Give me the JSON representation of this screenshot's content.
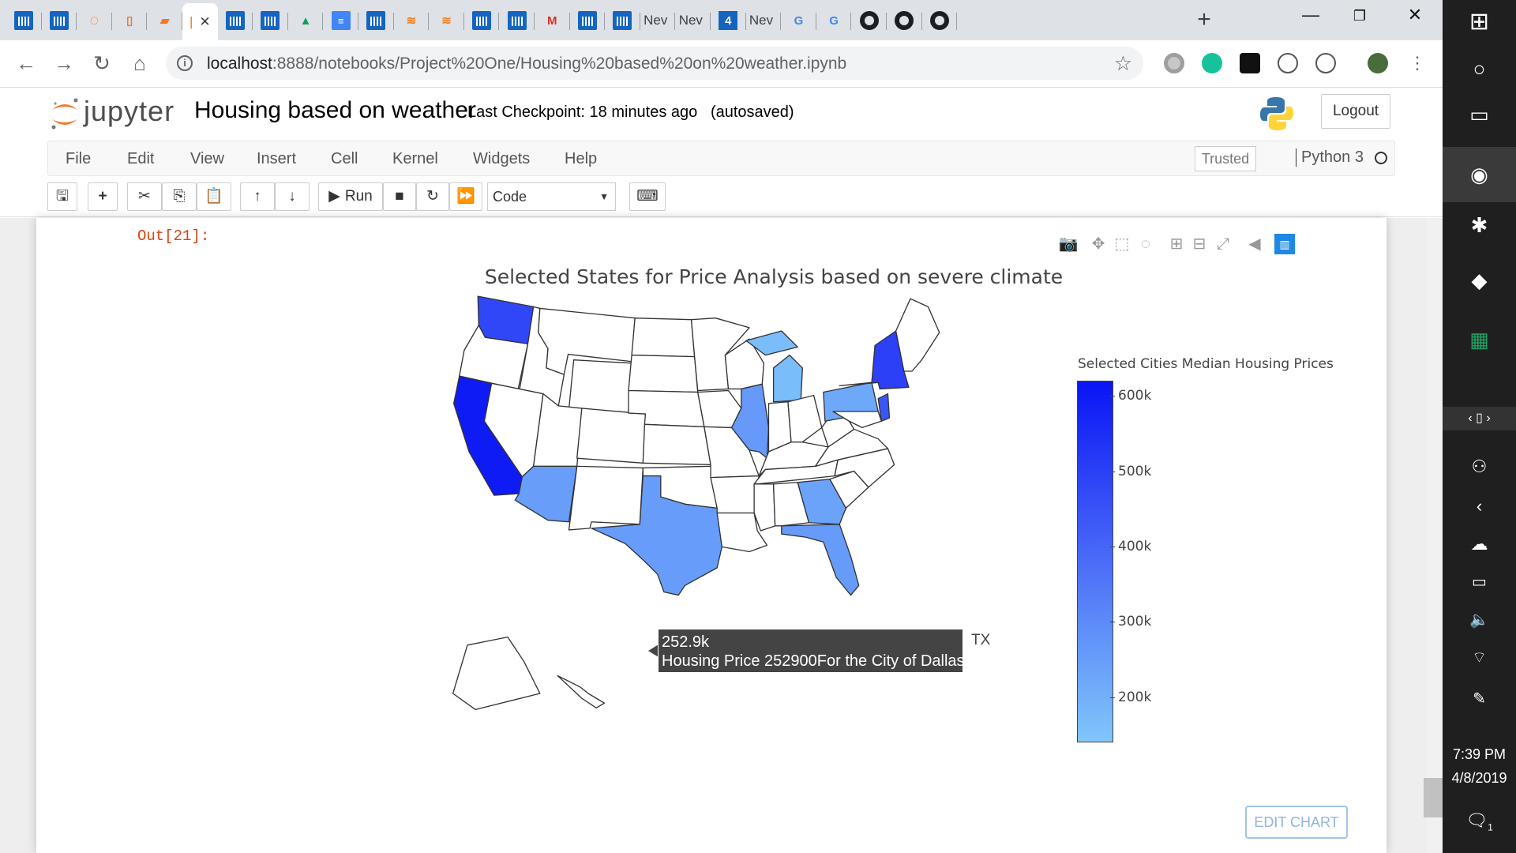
{
  "browser": {
    "tabs": [
      {
        "icon": "plotly-icon"
      },
      {
        "icon": "plotly-icon"
      },
      {
        "icon": "jupyter-icon"
      },
      {
        "icon": "document-icon"
      },
      {
        "icon": "book-icon"
      },
      {
        "icon": "active-tab",
        "close": "✕"
      },
      {
        "icon": "plotly-icon"
      },
      {
        "icon": "plotly-icon"
      },
      {
        "icon": "drive-icon"
      },
      {
        "icon": "docs-icon"
      },
      {
        "icon": "plotly-icon"
      },
      {
        "icon": "stackoverflow-icon"
      },
      {
        "icon": "stackoverflow-icon"
      },
      {
        "icon": "plotly-icon"
      },
      {
        "icon": "plotly-icon"
      },
      {
        "icon": "gmail-icon"
      },
      {
        "icon": "plotly-icon"
      },
      {
        "icon": "plotly-icon"
      },
      {
        "icon": "text",
        "label": "Nev"
      },
      {
        "icon": "text",
        "label": "Nev"
      },
      {
        "icon": "four-icon"
      },
      {
        "icon": "text",
        "label": "Nev"
      },
      {
        "icon": "google-icon"
      },
      {
        "icon": "google-icon"
      },
      {
        "icon": "github-icon"
      },
      {
        "icon": "github-icon"
      },
      {
        "icon": "github-icon"
      }
    ],
    "url_host": "localhost",
    "url_path": ":8888/notebooks/Project%20One/Housing%20based%20on%20weather.ipynb"
  },
  "jupyter": {
    "logo_text": "jupyter",
    "notebook_title": "Housing based on weather",
    "checkpoint": "Last Checkpoint: 18 minutes ago",
    "autosave": "(autosaved)",
    "logout": "Logout",
    "menus": [
      "File",
      "Edit",
      "View",
      "Insert",
      "Cell",
      "Kernel",
      "Widgets",
      "Help"
    ],
    "trusted": "Trusted",
    "kernel": "Python 3",
    "run_label": "Run",
    "cell_type": "Code",
    "out_prompt": "Out[21]:"
  },
  "plot": {
    "title": "Selected States for Price Analysis based on severe climate",
    "colorbar_title": "Selected Cities Median Housing Prices",
    "colorbar_ticks": [
      "600k",
      "500k",
      "400k",
      "300k",
      "200k"
    ],
    "hover_value": "252.9k",
    "hover_text": "Housing Price 252900For the City of  Dallas",
    "hover_label": "TX",
    "edit_button": "EDIT CHART",
    "colors": {
      "max": "#0a14f5",
      "mid": "#4b6cf8",
      "min": "#80c6fb",
      "hover_bg": "#444444"
    }
  },
  "chart_data": {
    "type": "choropleth",
    "title": "Selected States for Price Analysis based on severe climate",
    "colorbar_title": "Selected Cities Median Housing Prices",
    "color_range": [
      140000,
      620000
    ],
    "tick_values": [
      600000,
      500000,
      400000,
      300000,
      200000
    ],
    "tick_labels": [
      "600k",
      "500k",
      "400k",
      "300k",
      "200k"
    ],
    "states": [
      {
        "state": "CA",
        "value": 600000
      },
      {
        "state": "WA",
        "value": 480000
      },
      {
        "state": "NY",
        "value": 500000
      },
      {
        "state": "NJ",
        "value": 440000
      },
      {
        "state": "TX",
        "value": 252900
      },
      {
        "state": "AZ",
        "value": 250000
      },
      {
        "state": "IL",
        "value": 260000
      },
      {
        "state": "GA",
        "value": 235000
      },
      {
        "state": "FL",
        "value": 255000
      },
      {
        "state": "PA",
        "value": 220000
      },
      {
        "state": "MI",
        "value": 165000
      }
    ]
  },
  "taskbar": {
    "time": "7:39 PM",
    "date": "4/8/2019",
    "notifications": "1"
  }
}
